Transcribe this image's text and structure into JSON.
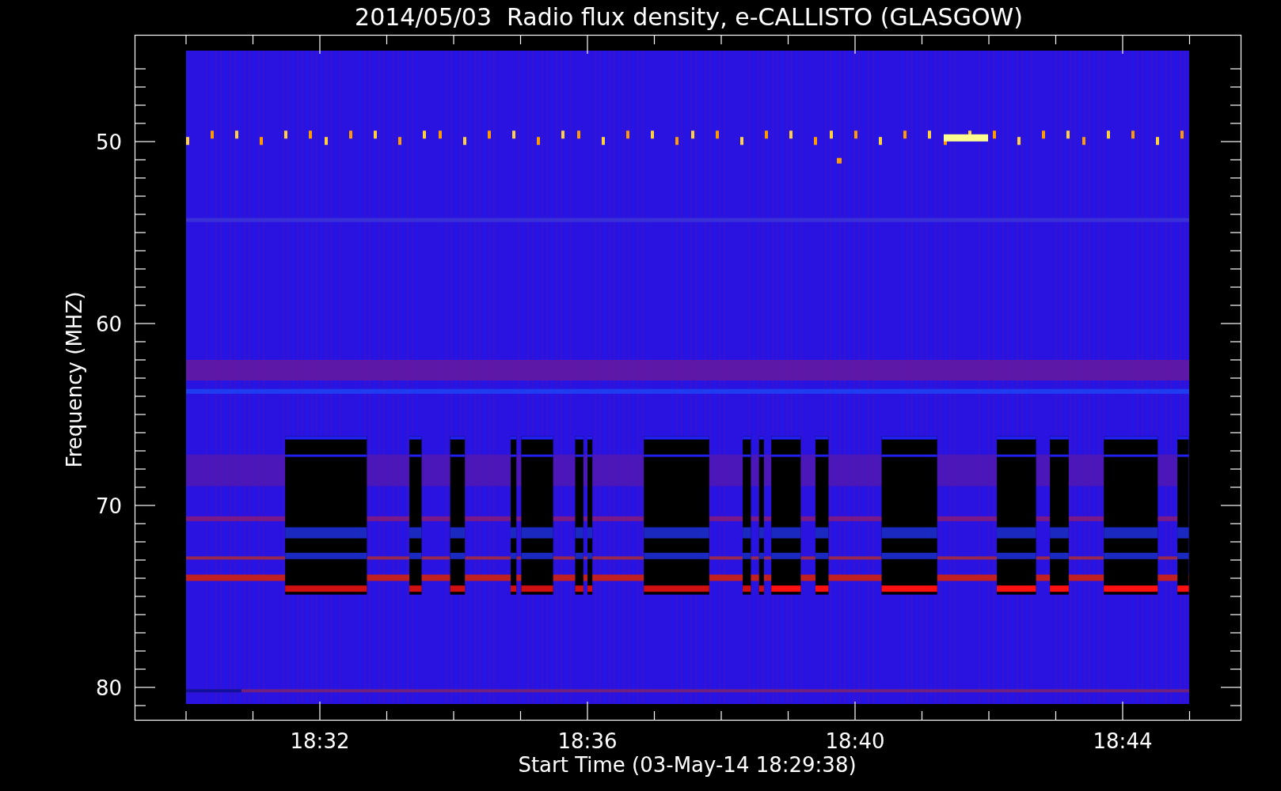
{
  "title": "2014/05/03  Radio flux density, e-CALLISTO (GLASGOW)",
  "y_axis": {
    "label": "Frequency (MHZ)",
    "ticks": [
      "50",
      "60",
      "70",
      "80"
    ]
  },
  "x_axis": {
    "label": "Start Time (03-May-14 18:29:38)",
    "ticks": [
      "18:32",
      "18:36",
      "18:40",
      "18:44"
    ]
  }
}
